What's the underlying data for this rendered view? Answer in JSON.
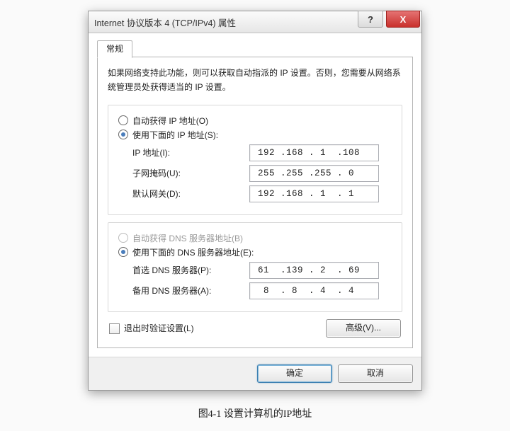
{
  "window": {
    "title": "Internet 协议版本 4 (TCP/IPv4) 属性",
    "help_glyph": "?",
    "close_glyph": "X"
  },
  "tab": {
    "label": "常规"
  },
  "description": "如果网络支持此功能，则可以获取自动指派的 IP 设置。否则，您需要从网络系统管理员处获得适当的 IP 设置。",
  "ip_section": {
    "auto_label": "自动获得 IP 地址(O)",
    "manual_label": "使用下面的 IP 地址(S):",
    "rows": {
      "ip": {
        "label": "IP 地址(I):",
        "value": " 192 .168 . 1  .108"
      },
      "mask": {
        "label": "子网掩码(U):",
        "value": " 255 .255 .255 . 0 "
      },
      "gateway": {
        "label": "默认网关(D):",
        "value": " 192 .168 . 1  . 1 "
      }
    }
  },
  "dns_section": {
    "auto_label": "自动获得 DNS 服务器地址(B)",
    "manual_label": "使用下面的 DNS 服务器地址(E):",
    "rows": {
      "primary": {
        "label": "首选 DNS 服务器(P):",
        "value": " 61  .139 . 2  . 69"
      },
      "alternate": {
        "label": "备用 DNS 服务器(A):",
        "value": "  8  . 8  . 4  . 4 "
      }
    }
  },
  "validate_label": "退出时验证设置(L)",
  "buttons": {
    "advanced": "高级(V)...",
    "ok": "确定",
    "cancel": "取消"
  },
  "figure_caption": "图4-1  设置计算机的IP地址"
}
